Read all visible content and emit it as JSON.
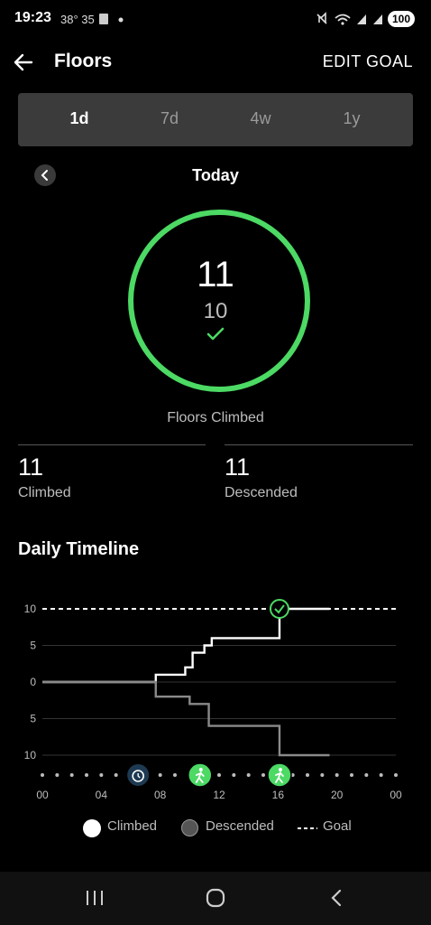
{
  "status_bar": {
    "time": "19:23",
    "meta": "38° 35",
    "battery": "100"
  },
  "header": {
    "title": "Floors",
    "edit_label": "EDIT GOAL"
  },
  "period_tabs": [
    {
      "label": "1d",
      "selected": true
    },
    {
      "label": "7d"
    },
    {
      "label": "4w"
    },
    {
      "label": "1y"
    }
  ],
  "date_label": "Today",
  "summary": {
    "value": "11",
    "goal": "10",
    "caption": "Floors Climbed"
  },
  "stats": {
    "climbed_value": "11",
    "climbed_label": "Climbed",
    "descended_value": "11",
    "descended_label": "Descended"
  },
  "timeline_title": "Daily Timeline",
  "legend": {
    "climbed": "Climbed",
    "descended": "Descended",
    "goal": "Goal"
  },
  "colors": {
    "accent": "#4cd964",
    "background": "#000000",
    "segment_bg": "#3b3b3b"
  },
  "chart_data": {
    "type": "line",
    "x_tick_labels": [
      "00",
      "04",
      "08",
      "12",
      "16",
      "20",
      "00"
    ],
    "y_tick_labels": [
      "10",
      "5",
      "0",
      "5",
      "10"
    ],
    "ylim": [
      -10,
      10
    ],
    "xlim": [
      0,
      24
    ],
    "goal": 10,
    "series": [
      {
        "name": "Climbed",
        "x": [
          0,
          7.7,
          9.7,
          10.2,
          11.0,
          11.5,
          16.1,
          19.5
        ],
        "y": [
          0,
          1,
          2,
          4,
          5,
          6,
          11,
          11
        ]
      },
      {
        "name": "Descended",
        "x": [
          0,
          7.7,
          10.0,
          11.3,
          16.1,
          19.5
        ],
        "y": [
          0,
          -2,
          -3,
          -6,
          -10,
          -10
        ]
      }
    ],
    "events": [
      {
        "type": "alarm-icon",
        "x": 6.5
      },
      {
        "type": "walk-icon",
        "x": 10.7
      },
      {
        "type": "walk-icon",
        "x": 16.1
      }
    ]
  }
}
